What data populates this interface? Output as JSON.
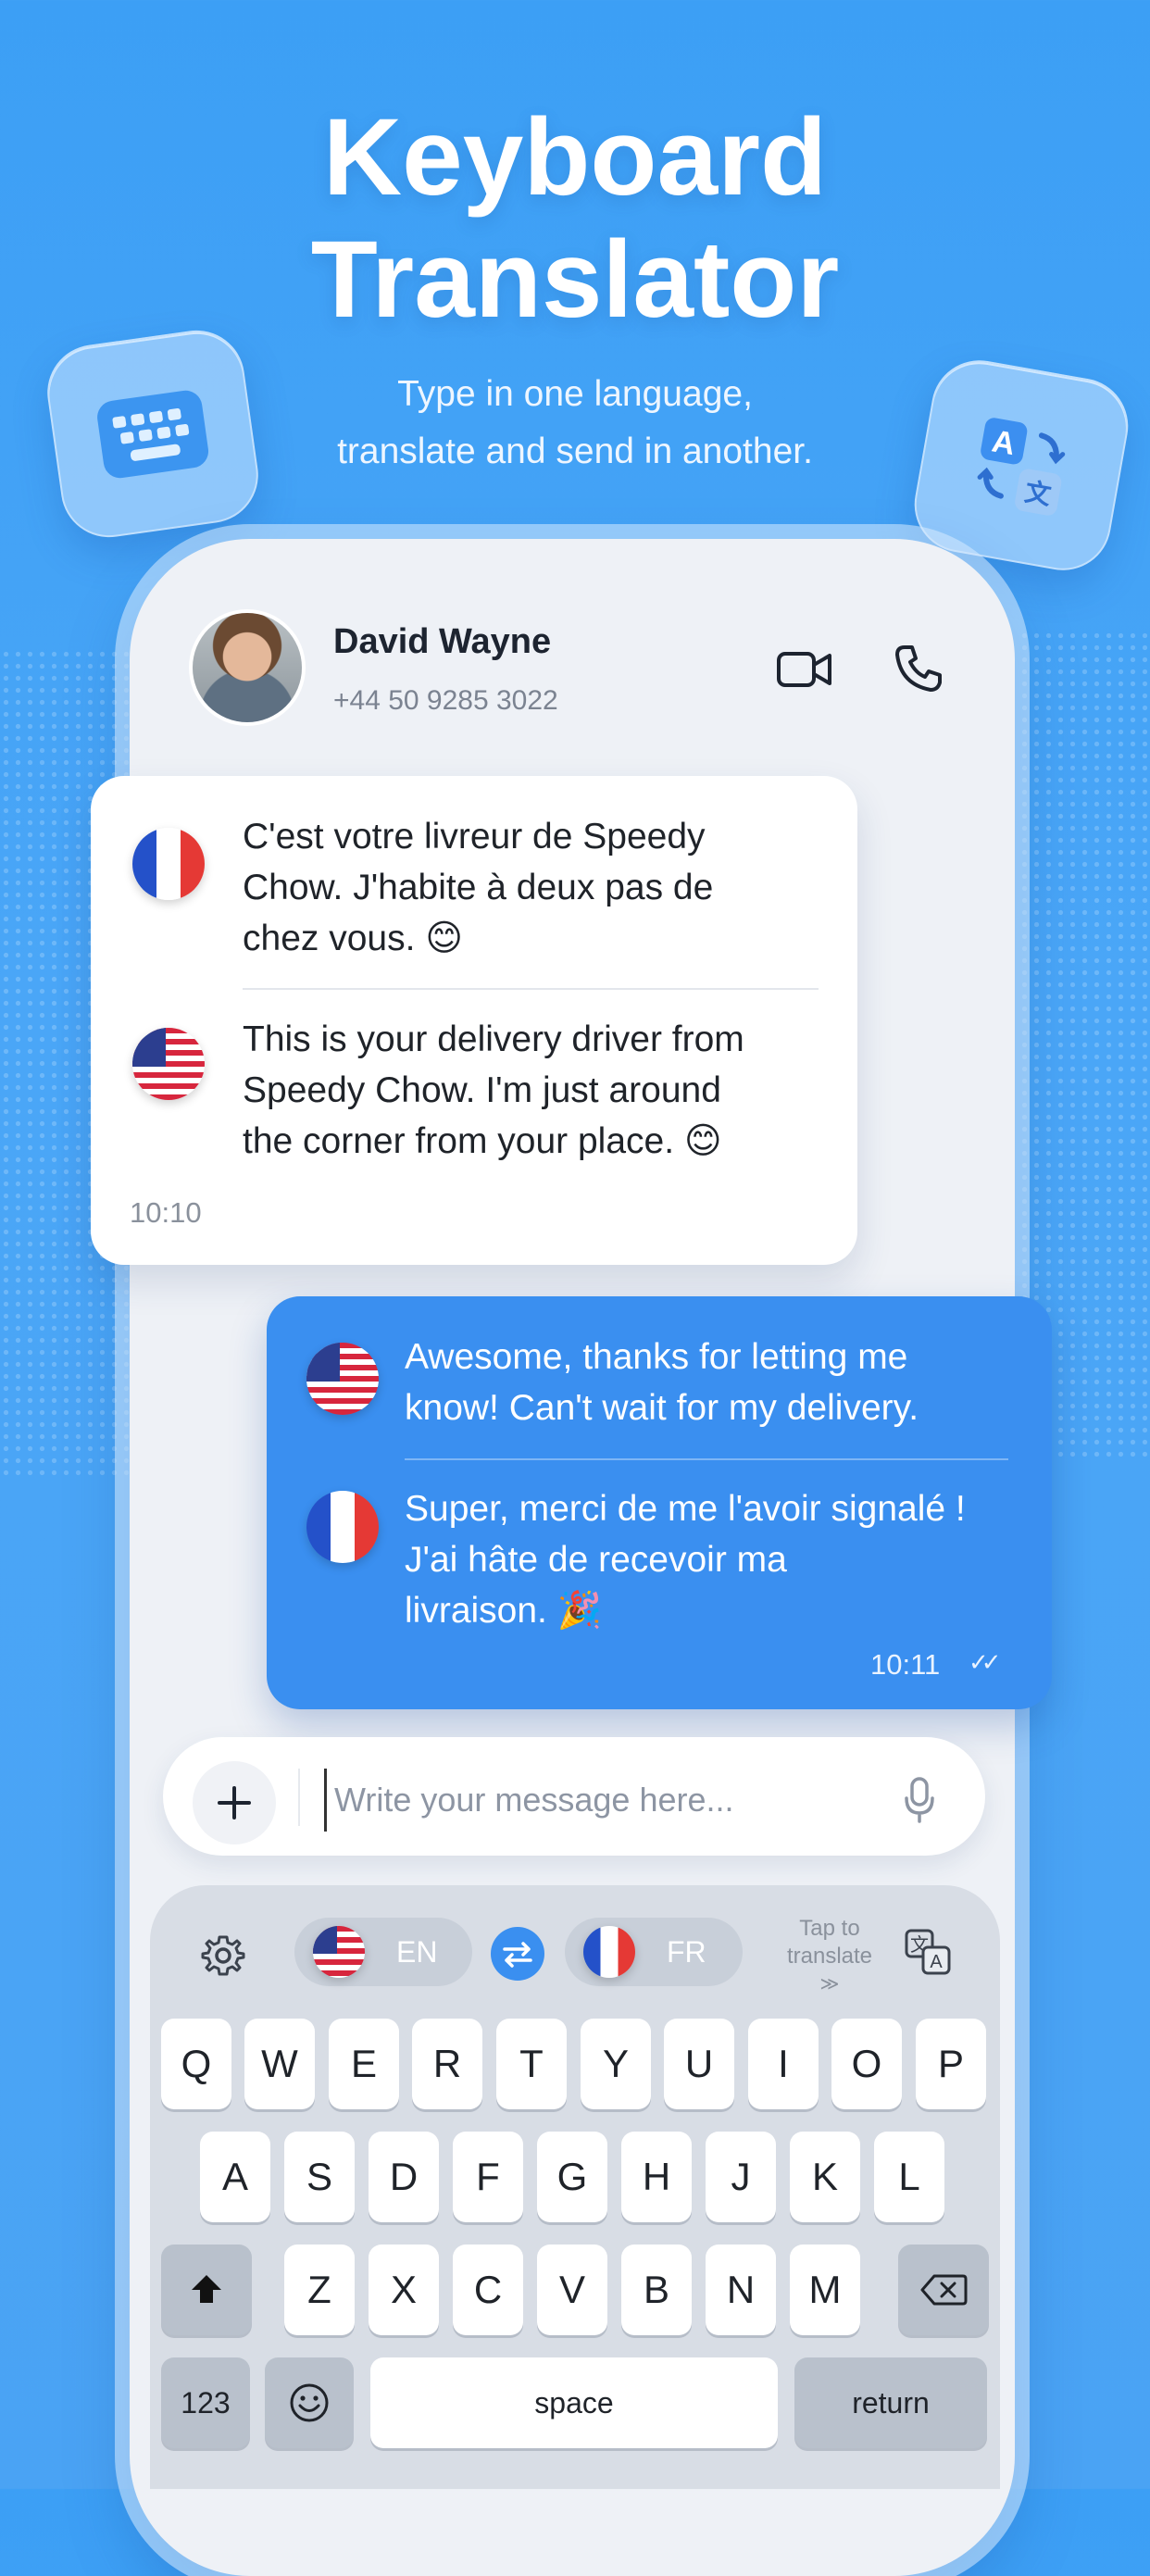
{
  "promo": {
    "title_line1": "Keyboard",
    "title_line2": "Translator",
    "subtitle_line1": "Type in one language,",
    "subtitle_line2": "translate and send in another."
  },
  "contact": {
    "name": "David Wayne",
    "phone": "+44 50 9285 3022"
  },
  "incoming": {
    "original_lang": "french-flag",
    "original_lines": [
      "C'est votre livreur de Speedy",
      "Chow. J'habite à deux pas de",
      "chez vous. 😊"
    ],
    "translated_lang": "us-flag",
    "translated_lines": [
      "This is your delivery driver from",
      "Speedy Chow. I'm just around",
      "the corner from your place. 😊"
    ],
    "time": "10:10"
  },
  "outgoing": {
    "original_lang": "us-flag",
    "original_lines": [
      "Awesome, thanks for letting me",
      "know! Can't wait for my delivery."
    ],
    "translated_lang": "french-flag",
    "translated_lines": [
      "Super, merci de me l'avoir signalé !",
      "J'ai hâte de recevoir ma",
      "livraison. 🎉"
    ],
    "time": "10:11",
    "status": "✓✓"
  },
  "composer": {
    "placeholder": "Write your message here..."
  },
  "keyboard": {
    "source_lang": "EN",
    "target_lang": "FR",
    "tap_line1": "Tap to",
    "tap_line2": "translate",
    "tap_line3": "≫",
    "row1": [
      "Q",
      "W",
      "E",
      "R",
      "T",
      "Y",
      "U",
      "I",
      "O",
      "P"
    ],
    "row2": [
      "A",
      "S",
      "D",
      "F",
      "G",
      "H",
      "J",
      "K",
      "L"
    ],
    "row3": [
      "Z",
      "X",
      "C",
      "V",
      "B",
      "N",
      "M"
    ],
    "numbers_key": "123",
    "space_key": "space",
    "return_key": "return"
  },
  "colors": {
    "background": "#4aa6f7",
    "accent": "#3a8ff0",
    "bubble_in": "#ffffff",
    "bubble_out": "#3a8ff0"
  }
}
